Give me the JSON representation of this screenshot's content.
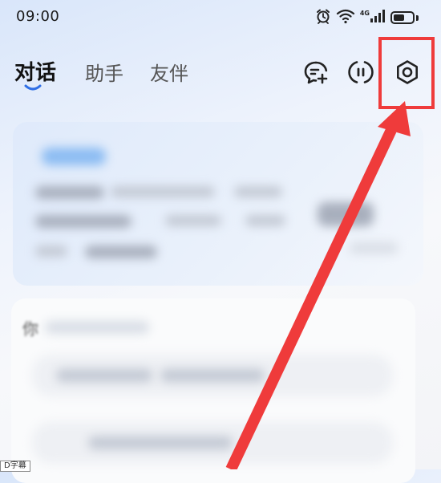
{
  "status_bar": {
    "time": "09:00",
    "network_label": "4G",
    "battery_level": 0.6,
    "icons": [
      "alarm-icon",
      "wifi-icon",
      "signal-icon",
      "battery-icon"
    ]
  },
  "header": {
    "tabs": [
      {
        "label": "对话",
        "active": true
      },
      {
        "label": "助手",
        "active": false
      },
      {
        "label": "友伴",
        "active": false
      }
    ],
    "actions": [
      "new-chat-icon",
      "voice-assistant-icon",
      "settings-icon"
    ]
  },
  "annotation": {
    "highlight_color": "#ef3b3b"
  },
  "card2": {
    "heading_glyph": "你"
  },
  "footer": {
    "tag_text": "D字幕"
  }
}
